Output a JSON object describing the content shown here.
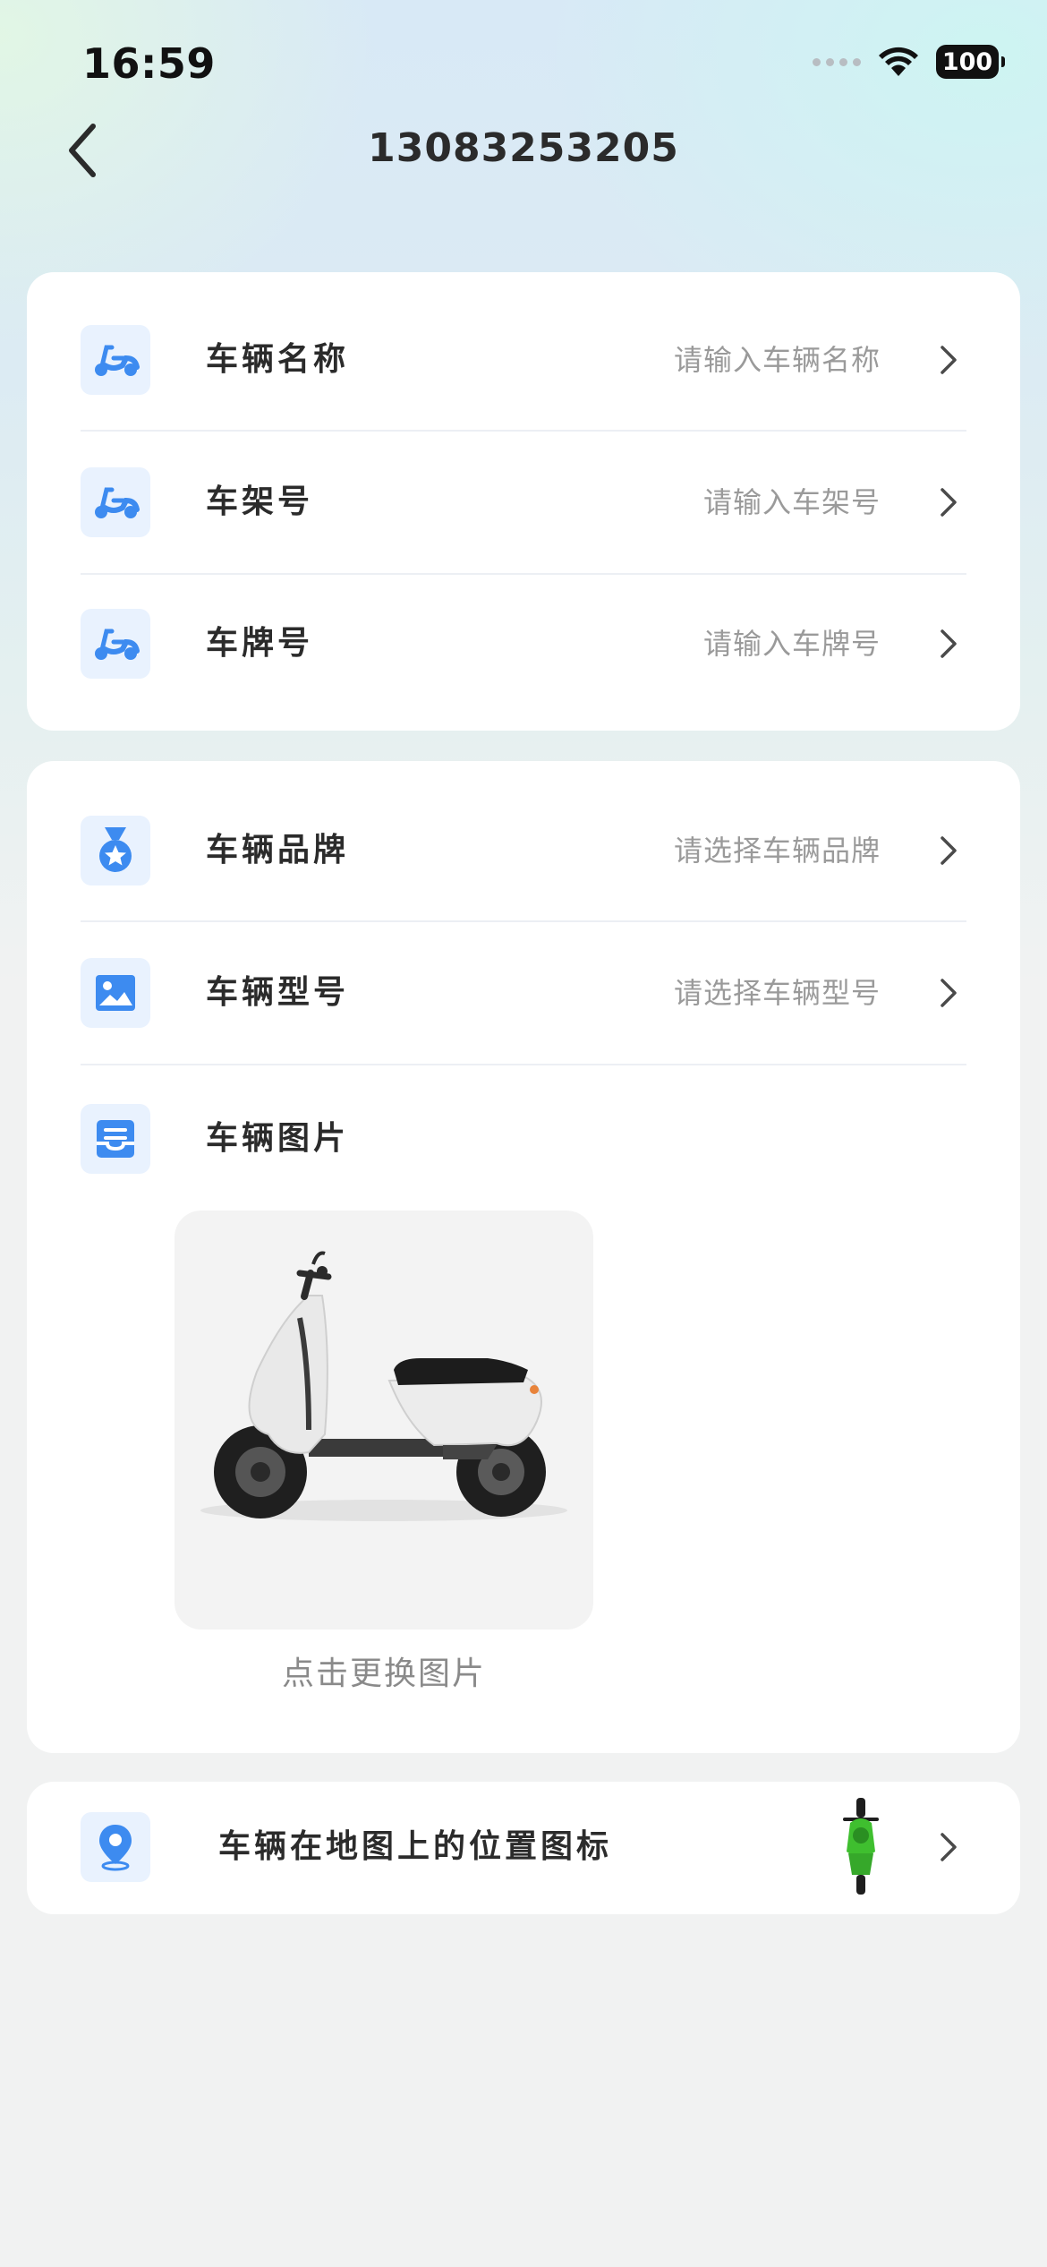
{
  "status_bar": {
    "time": "16:59",
    "battery": "100"
  },
  "nav": {
    "title": "13083253205"
  },
  "basic_info": [
    {
      "label": "车辆名称",
      "value": "请输入车辆名称",
      "icon": "scooter-icon"
    },
    {
      "label": "车架号",
      "value": "请输入车架号",
      "icon": "scooter-icon"
    },
    {
      "label": "车牌号",
      "value": "请输入车牌号",
      "icon": "scooter-icon"
    }
  ],
  "model_info": [
    {
      "label": "车辆品牌",
      "value": "请选择车辆品牌",
      "icon": "medal-icon"
    },
    {
      "label": "车辆型号",
      "value": "请选择车辆型号",
      "icon": "image-icon"
    }
  ],
  "photo_section": {
    "label": "车辆图片",
    "icon": "list-icon",
    "caption": "点击更换图片"
  },
  "map_icon_row": {
    "label": "车辆在地图上的位置图标",
    "icon": "location-pin-icon"
  },
  "colors": {
    "accent": "#3d8bf0",
    "icon_bg": "#e9f2fe",
    "placeholder": "#9a9a9a",
    "map_marker": "#3fbf2f"
  }
}
